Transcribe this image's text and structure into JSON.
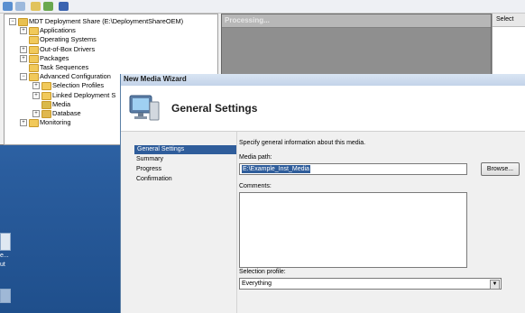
{
  "mmc": {
    "processing": "Processing...",
    "right_header": "Select",
    "tree": [
      {
        "label": "MDT Deployment Share (E:\\DeploymentShareOEM)",
        "level": 1,
        "expander": "−",
        "icon": "deployment-share-icon"
      },
      {
        "label": "Applications",
        "level": 2,
        "expander": "+",
        "icon": "folder-icon"
      },
      {
        "label": "Operating Systems",
        "level": 2,
        "expander": "",
        "icon": "folder-icon"
      },
      {
        "label": "Out-of-Box Drivers",
        "level": 2,
        "expander": "+",
        "icon": "folder-icon"
      },
      {
        "label": "Packages",
        "level": 2,
        "expander": "+",
        "icon": "folder-icon"
      },
      {
        "label": "Task Sequences",
        "level": 2,
        "expander": "",
        "icon": "folder-icon"
      },
      {
        "label": "Advanced Configuration",
        "level": 2,
        "expander": "−",
        "icon": "folder-icon"
      },
      {
        "label": "Selection Profiles",
        "level": 3,
        "expander": "+",
        "icon": "folder-icon"
      },
      {
        "label": "Linked Deployment S",
        "level": 3,
        "expander": "+",
        "icon": "folder-icon"
      },
      {
        "label": "Media",
        "level": 3,
        "expander": "",
        "icon": "media-icon"
      },
      {
        "label": "Database",
        "level": 3,
        "expander": "+",
        "icon": "database-icon"
      },
      {
        "label": "Monitoring",
        "level": 2,
        "expander": "+",
        "icon": "folder-icon"
      }
    ]
  },
  "desktop": {
    "icon_label_1": "e...",
    "icon_label_2": "ut"
  },
  "wizard": {
    "title": "New Media Wizard",
    "heading": "General Settings",
    "nav": [
      "General Settings",
      "Summary",
      "Progress",
      "Confirmation"
    ],
    "selected_nav": 0,
    "description": "Specify general information about this media.",
    "media_path_label": "Media path:",
    "media_path_value": "E:\\Example_Inst_Media",
    "browse_label": "Browse...",
    "comments_label": "Comments:",
    "comments_value": "",
    "selection_profile_label": "Selection profile:",
    "selection_profile_value": "Everything"
  },
  "colors": {
    "selection": "#2f5d9b",
    "desktop": "#2f66a8",
    "folder": "#f1c95a"
  }
}
